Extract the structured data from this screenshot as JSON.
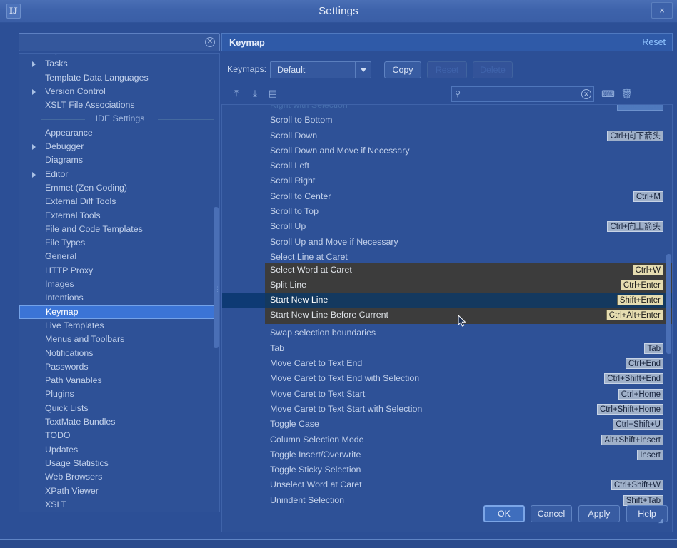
{
  "window": {
    "title": "Settings",
    "app_icon": "idea-app-icon",
    "close_label": "×"
  },
  "sidebar": {
    "search_value": "",
    "search_placeholder": "",
    "clear_icon": "✕",
    "items": [
      {
        "label": "SQL Dialects",
        "expandable": false,
        "partial": true,
        "selected": false
      },
      {
        "label": "Tasks",
        "expandable": true,
        "partial": false,
        "selected": false
      },
      {
        "label": "Template Data Languages",
        "expandable": false,
        "partial": false,
        "selected": false
      },
      {
        "label": "Version Control",
        "expandable": true,
        "partial": false,
        "selected": false
      },
      {
        "label": "XSLT File Associations",
        "expandable": false,
        "partial": false,
        "selected": false
      },
      {
        "label": "IDE Settings",
        "group": true
      },
      {
        "label": "Appearance",
        "expandable": false,
        "partial": false,
        "selected": false
      },
      {
        "label": "Debugger",
        "expandable": true,
        "partial": false,
        "selected": false
      },
      {
        "label": "Diagrams",
        "expandable": false,
        "partial": false,
        "selected": false
      },
      {
        "label": "Editor",
        "expandable": true,
        "partial": false,
        "selected": false
      },
      {
        "label": "Emmet (Zen Coding)",
        "expandable": false,
        "partial": false,
        "selected": false
      },
      {
        "label": "External Diff Tools",
        "expandable": false,
        "partial": false,
        "selected": false
      },
      {
        "label": "External Tools",
        "expandable": false,
        "partial": false,
        "selected": false
      },
      {
        "label": "File and Code Templates",
        "expandable": false,
        "partial": false,
        "selected": false
      },
      {
        "label": "File Types",
        "expandable": false,
        "partial": false,
        "selected": false
      },
      {
        "label": "General",
        "expandable": false,
        "partial": false,
        "selected": false
      },
      {
        "label": "HTTP Proxy",
        "expandable": false,
        "partial": false,
        "selected": false
      },
      {
        "label": "Images",
        "expandable": false,
        "partial": false,
        "selected": false
      },
      {
        "label": "Intentions",
        "expandable": false,
        "partial": false,
        "selected": false
      },
      {
        "label": "Keymap",
        "expandable": false,
        "partial": false,
        "selected": true
      },
      {
        "label": "Live Templates",
        "expandable": false,
        "partial": false,
        "selected": false
      },
      {
        "label": "Menus and Toolbars",
        "expandable": false,
        "partial": false,
        "selected": false
      },
      {
        "label": "Notifications",
        "expandable": false,
        "partial": false,
        "selected": false
      },
      {
        "label": "Passwords",
        "expandable": false,
        "partial": false,
        "selected": false
      },
      {
        "label": "Path Variables",
        "expandable": false,
        "partial": false,
        "selected": false
      },
      {
        "label": "Plugins",
        "expandable": false,
        "partial": false,
        "selected": false
      },
      {
        "label": "Quick Lists",
        "expandable": false,
        "partial": false,
        "selected": false
      },
      {
        "label": "TextMate Bundles",
        "expandable": false,
        "partial": false,
        "selected": false
      },
      {
        "label": "TODO",
        "expandable": false,
        "partial": false,
        "selected": false
      },
      {
        "label": "Updates",
        "expandable": false,
        "partial": false,
        "selected": false
      },
      {
        "label": "Usage Statistics",
        "expandable": false,
        "partial": false,
        "selected": false
      },
      {
        "label": "Web Browsers",
        "expandable": false,
        "partial": false,
        "selected": false
      },
      {
        "label": "XPath Viewer",
        "expandable": false,
        "partial": false,
        "selected": false
      },
      {
        "label": "XSLT",
        "expandable": false,
        "partial": false,
        "selected": false
      }
    ]
  },
  "panel": {
    "title": "Keymap",
    "reset_link": "Reset",
    "keymaps_label": "Keymaps:",
    "keymap_selected": "Default",
    "buttons": {
      "copy": "Copy",
      "reset": "Reset",
      "delete": "Delete"
    },
    "toolbar": {
      "expand_all_icon": "expand-all-icon",
      "collapse_all_icon": "collapse-all-icon",
      "edit-shortcut_icon": "edit-shortcut-icon",
      "search_value": "",
      "search_placeholder": "",
      "search_icon": "⚲",
      "clear_icon": "✕",
      "find_shortcut_icon": "find-by-shortcut-icon",
      "trash_icon": "Ὕ1"
    },
    "actions": [
      {
        "label": "Right with Selection",
        "shortcut": "Shift+Right",
        "partial": true
      },
      {
        "label": "Scroll to Bottom",
        "shortcut": ""
      },
      {
        "label": "Scroll Down",
        "shortcut": "Ctrl+向下箭头"
      },
      {
        "label": "Scroll Down and Move if Necessary",
        "shortcut": ""
      },
      {
        "label": "Scroll Left",
        "shortcut": ""
      },
      {
        "label": "Scroll Right",
        "shortcut": ""
      },
      {
        "label": "Scroll to Center",
        "shortcut": "Ctrl+M"
      },
      {
        "label": "Scroll to Top",
        "shortcut": ""
      },
      {
        "label": "Scroll Up",
        "shortcut": "Ctrl+向上箭头"
      },
      {
        "label": "Scroll Up and Move if Necessary",
        "shortcut": ""
      },
      {
        "label": "Select Line at Caret",
        "shortcut": ""
      },
      {
        "label": "Select Word at Caret",
        "shortcut": "Ctrl+W"
      },
      {
        "label": "Split Line",
        "shortcut": "Ctrl+Enter"
      },
      {
        "label": "Start New Line",
        "shortcut": "Shift+Enter"
      },
      {
        "label": "Start New Line Before Current",
        "shortcut": "Ctrl+Alt+Enter"
      },
      {
        "label": "Swap selection boundaries",
        "shortcut": ""
      },
      {
        "label": "Tab",
        "shortcut": "Tab"
      },
      {
        "label": "Move Caret to Text End",
        "shortcut": "Ctrl+End"
      },
      {
        "label": "Move Caret to Text End with Selection",
        "shortcut": "Ctrl+Shift+End"
      },
      {
        "label": "Move Caret to Text Start",
        "shortcut": "Ctrl+Home"
      },
      {
        "label": "Move Caret to Text Start with Selection",
        "shortcut": "Ctrl+Shift+Home"
      },
      {
        "label": "Toggle Case",
        "shortcut": "Ctrl+Shift+U"
      },
      {
        "label": "Column Selection Mode",
        "shortcut": "Alt+Shift+Insert"
      },
      {
        "label": "Toggle Insert/Overwrite",
        "shortcut": "Insert"
      },
      {
        "label": "Toggle Sticky Selection",
        "shortcut": ""
      },
      {
        "label": "Unselect Word at Caret",
        "shortcut": "Ctrl+Shift+W"
      },
      {
        "label": "Unindent Selection",
        "shortcut": "Shift+Tab"
      }
    ],
    "hover_overlay": [
      {
        "label": "Select Word at Caret",
        "shortcut": "Ctrl+W",
        "selected": false
      },
      {
        "label": "Split Line",
        "shortcut": "Ctrl+Enter",
        "selected": false
      },
      {
        "label": "Start New Line",
        "shortcut": "Shift+Enter",
        "selected": true
      },
      {
        "label": "Start New Line Before Current",
        "shortcut": "Ctrl+Alt+Enter",
        "selected": false
      }
    ]
  },
  "footer": {
    "ok": "OK",
    "cancel": "Cancel",
    "apply": "Apply",
    "help": "Help"
  }
}
